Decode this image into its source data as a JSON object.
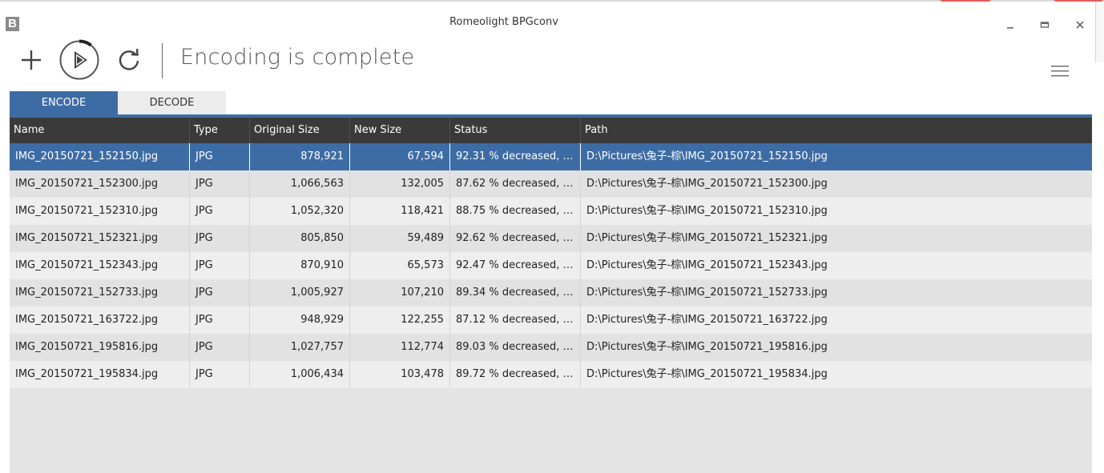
{
  "window": {
    "title": "Romeolight BPGconv",
    "app_icon_letter": "B",
    "minimize_label": "_"
  },
  "toolbar": {
    "status": "Encoding is complete"
  },
  "tabs": [
    {
      "label": "ENCODE",
      "active": true
    },
    {
      "label": "DECODE",
      "active": false
    }
  ],
  "table": {
    "columns": [
      "Name",
      "Type",
      "Original Size",
      "New Size",
      "Status",
      "Path"
    ],
    "rows": [
      {
        "name": "IMG_20150721_152150.jpg",
        "type": "JPG",
        "original_size": "878,921",
        "new_size": "67,594",
        "status": "92.31 % decreased, x...",
        "path": "D:\\Pictures\\兔子-棕\\IMG_20150721_152150.jpg"
      },
      {
        "name": "IMG_20150721_152300.jpg",
        "type": "JPG",
        "original_size": "1,066,563",
        "new_size": "132,005",
        "status": "87.62 % decreased, x...",
        "path": "D:\\Pictures\\兔子-棕\\IMG_20150721_152300.jpg"
      },
      {
        "name": "IMG_20150721_152310.jpg",
        "type": "JPG",
        "original_size": "1,052,320",
        "new_size": "118,421",
        "status": "88.75 % decreased, x...",
        "path": "D:\\Pictures\\兔子-棕\\IMG_20150721_152310.jpg"
      },
      {
        "name": "IMG_20150721_152321.jpg",
        "type": "JPG",
        "original_size": "805,850",
        "new_size": "59,489",
        "status": "92.62 % decreased, x...",
        "path": "D:\\Pictures\\兔子-棕\\IMG_20150721_152321.jpg"
      },
      {
        "name": "IMG_20150721_152343.jpg",
        "type": "JPG",
        "original_size": "870,910",
        "new_size": "65,573",
        "status": "92.47 % decreased, x...",
        "path": "D:\\Pictures\\兔子-棕\\IMG_20150721_152343.jpg"
      },
      {
        "name": "IMG_20150721_152733.jpg",
        "type": "JPG",
        "original_size": "1,005,927",
        "new_size": "107,210",
        "status": "89.34 % decreased, x...",
        "path": "D:\\Pictures\\兔子-棕\\IMG_20150721_152733.jpg"
      },
      {
        "name": "IMG_20150721_163722.jpg",
        "type": "JPG",
        "original_size": "948,929",
        "new_size": "122,255",
        "status": "87.12 % decreased, x...",
        "path": "D:\\Pictures\\兔子-棕\\IMG_20150721_163722.jpg"
      },
      {
        "name": "IMG_20150721_195816.jpg",
        "type": "JPG",
        "original_size": "1,027,757",
        "new_size": "112,774",
        "status": "89.03 % decreased, x...",
        "path": "D:\\Pictures\\兔子-棕\\IMG_20150721_195816.jpg"
      },
      {
        "name": "IMG_20150721_195834.jpg",
        "type": "JPG",
        "original_size": "1,006,434",
        "new_size": "103,478",
        "status": "89.72 % decreased, x...",
        "path": "D:\\Pictures\\兔子-棕\\IMG_20150721_195834.jpg"
      }
    ],
    "selected_index": 0
  },
  "colors": {
    "accent": "#3d6ca5",
    "header_bg": "#3a3a3a",
    "grid_bg": "#e4e4e4"
  },
  "icons": {
    "add": "plus-icon",
    "start": "play-circle-icon",
    "refresh": "refresh-icon",
    "menu": "hamburger-menu-icon",
    "minimize": "minimize-icon",
    "maximize": "maximize-icon",
    "close": "close-icon"
  }
}
